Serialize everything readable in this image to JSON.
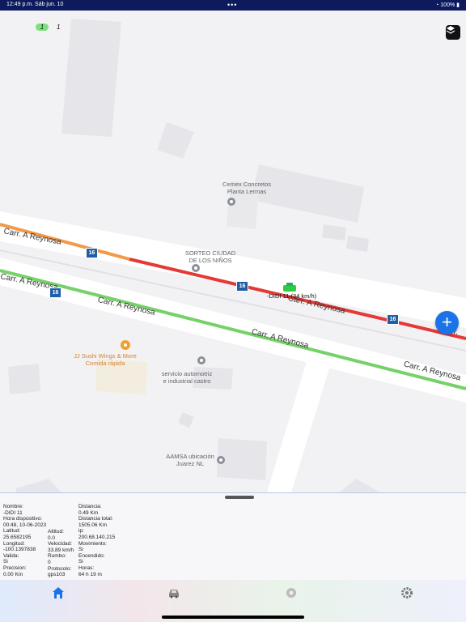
{
  "status_bar": {
    "time": "12:49 p.m.",
    "date": "Sáb jun. 10",
    "battery": "100%"
  },
  "map": {
    "counters": [
      "1",
      "1"
    ],
    "pois": [
      {
        "line1": "Cemex Concretos",
        "line2": "Planta Lermas"
      },
      {
        "line1": "SORTEO CIUDAD",
        "line2": "DE LOS NIÑOS"
      },
      {
        "line1": "JJ Sushi Wings & More",
        "line2": "Comida rápida"
      },
      {
        "line1": "servicio automotriz",
        "line2": "e industrial castro"
      },
      {
        "line1": "AAMSA ubicación",
        "line2": "Juarez NL"
      }
    ],
    "road_name": "Carr. A Reynosa",
    "road_labels": [
      "Carr. A Reynosa",
      "Carr. A Reynosa",
      "Carr. A Reynosa",
      "Carr. A Reynosa",
      "Carr. A Reynosa",
      "Carr. A Reynosa",
      "Carr."
    ],
    "highway_number": "16",
    "vehicle_label": "-DIDI 11 (34 km/h)",
    "colors": {
      "green_route": "#76d16a",
      "red_route": "#e53935",
      "orange_route": "#f2994a",
      "accent": "#1a73e8"
    }
  },
  "details": {
    "col1": [
      {
        "label": "Nombre:",
        "value": "-DIDI 11"
      },
      {
        "label": "Hora dispositivo:",
        "value": "00:48, 10-06-2023"
      },
      {
        "label": "Latitud:",
        "value": "25.6582195"
      },
      {
        "label": "Longitud:",
        "value": "-100.1397838"
      },
      {
        "label": "Valida:",
        "value": "Si"
      },
      {
        "label": "Precision:",
        "value": "0.00 Km"
      }
    ],
    "col2": [
      {
        "label": "Altitud:",
        "value": "0.0"
      },
      {
        "label": "Velocidad:",
        "value": "33.89 km/h"
      },
      {
        "label": "Rumbo:",
        "value": "0"
      },
      {
        "label": "Protocolo:",
        "value": "gps103"
      }
    ],
    "col3": [
      {
        "label": "Distancia:",
        "value": "0.49 Km"
      },
      {
        "label": "Distancia total:",
        "value": "1505.06 Km"
      },
      {
        "label": "ip:",
        "value": "200.68.140.215"
      },
      {
        "label": "Movimiento:",
        "value": "Si"
      },
      {
        "label": "Encendido:",
        "value": "Si"
      },
      {
        "label": "Horas:",
        "value": "64 h 19 m"
      }
    ]
  },
  "tabs": [
    {
      "icon": "home-icon",
      "active": true
    },
    {
      "icon": "car-icon",
      "active": false
    },
    {
      "icon": "report-icon",
      "active": false
    },
    {
      "icon": "gear-icon",
      "active": false
    }
  ]
}
